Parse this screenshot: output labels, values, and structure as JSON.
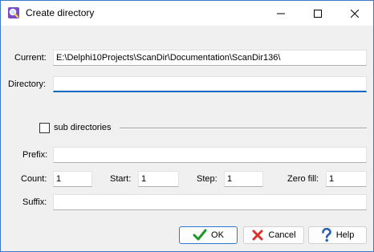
{
  "window": {
    "title": "Create directory"
  },
  "form": {
    "current_label": "Current:",
    "current_value": "E:\\Delphi10Projects\\ScanDir\\Documentation\\ScanDir136\\",
    "directory_label": "Directory:",
    "directory_value": "",
    "subdirs_label": "sub directories",
    "subdirs_checked": false,
    "prefix_label": "Prefix:",
    "prefix_value": "",
    "count_label": "Count:",
    "count_value": "1",
    "start_label": "Start:",
    "start_value": "1",
    "step_label": "Step:",
    "step_value": "1",
    "zerofill_label": "Zero fill:",
    "zerofill_value": "1",
    "suffix_label": "Suffix:",
    "suffix_value": ""
  },
  "buttons": {
    "ok_label": "OK",
    "cancel_label": "Cancel",
    "help_label": "Help"
  },
  "icons": {
    "app": "magnifier-folder-icon",
    "ok": "checkmark-icon",
    "cancel": "x-cross-icon",
    "help": "question-mark-icon"
  },
  "colors": {
    "accent": "#0067c0",
    "ok_icon": "#1a9a2a",
    "cancel_icon": "#d8332b",
    "help_icon": "#2b5fb4"
  }
}
